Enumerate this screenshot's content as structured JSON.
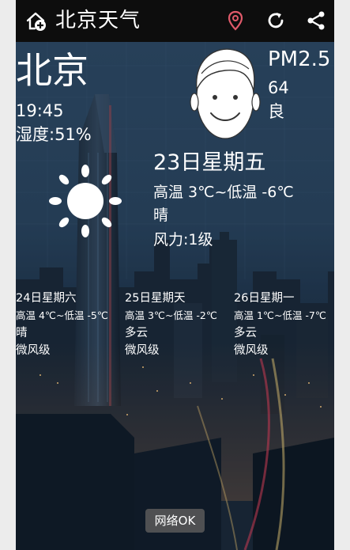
{
  "app": {
    "title": "北京天气"
  },
  "toolbar": {
    "home_icon": "home-plus-icon",
    "location_icon": "location-pin-icon",
    "refresh_icon": "refresh-icon",
    "share_icon": "share-icon"
  },
  "current": {
    "city": "北京",
    "time": "19:45",
    "humidity": "湿度:51%",
    "pm_label": "PM2.5",
    "pm_value": "64",
    "pm_quality": "良",
    "date": "23日星期五",
    "temp_range": "高温 3℃~低温 -6℃",
    "condition": "晴",
    "wind": "风力:1级",
    "condition_icon": "sun-icon",
    "air_face_icon": "smiley-face-icon"
  },
  "forecast": [
    {
      "date": "24日星期六",
      "temp": "高温 4℃~低温 -5℃",
      "condition": "晴",
      "wind": "微风级"
    },
    {
      "date": "25日星期天",
      "temp": "高温 3℃~低温 -2℃",
      "condition": "多云",
      "wind": "微风级"
    },
    {
      "date": "26日星期一",
      "temp": "高温 1℃~低温 -7℃",
      "condition": "多云",
      "wind": "微风级"
    }
  ],
  "toast": "网络OK",
  "colors": {
    "topbar": "#0d0d0d",
    "text": "#ffffff",
    "location_pin": "#e05a6a",
    "toast_bg": "#5a5a5a"
  }
}
